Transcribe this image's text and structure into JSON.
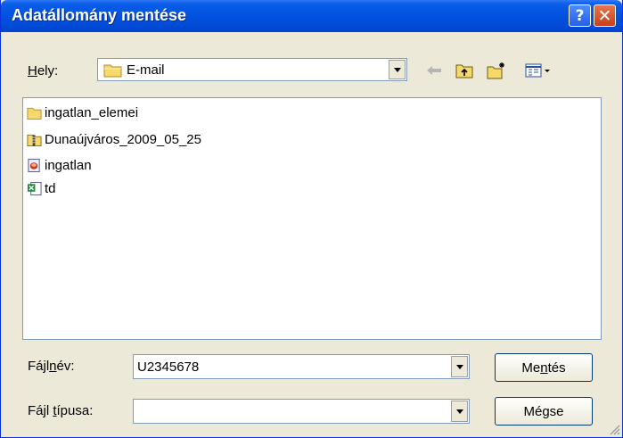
{
  "window": {
    "title": "Adatállomány mentése",
    "help_label": "?",
    "close_label": "✕"
  },
  "location": {
    "label_pre": "",
    "label_u": "H",
    "label_post": "ely:",
    "value": "E-mail"
  },
  "files": [
    {
      "name": "ingatlan_elemei",
      "icon": "folder-icon"
    },
    {
      "name": "Dunaújváros_2009_05_25",
      "icon": "zip-folder-icon"
    },
    {
      "name": "ingatlan",
      "icon": "database-file-icon"
    },
    {
      "name": "td",
      "icon": "excel-file-icon"
    }
  ],
  "filename": {
    "label_pre": "Fájl",
    "label_u": "n",
    "label_post": "év:",
    "value": "U2345678"
  },
  "filetype": {
    "label_pre": "Fájl ",
    "label_u": "t",
    "label_post": "ípusa:",
    "value": ""
  },
  "buttons": {
    "save_pre": "Me",
    "save_u": "n",
    "save_post": "tés",
    "cancel": "Mégse"
  }
}
